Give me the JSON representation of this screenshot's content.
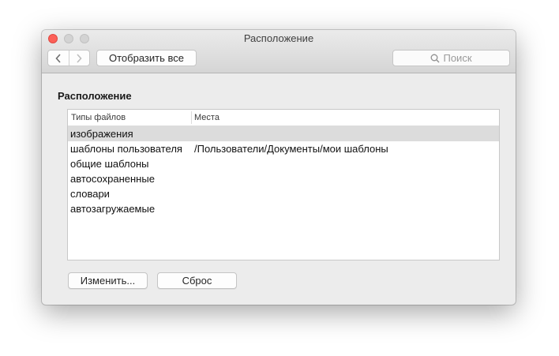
{
  "window": {
    "title": "Расположение"
  },
  "toolbar": {
    "show_all_label": "Отобразить все",
    "search_placeholder": "Поиск",
    "icons": [
      "chevron-left-icon",
      "chevron-right-icon",
      "search-icon"
    ]
  },
  "section": {
    "title": "Расположение"
  },
  "table": {
    "columns": [
      "Типы файлов",
      "Места"
    ],
    "rows": [
      {
        "type": "изображения",
        "location": ""
      },
      {
        "type": "шаблоны пользователя",
        "location": "/Пользователи/Документы/мои шаблоны"
      },
      {
        "type": "общие шаблоны",
        "location": ""
      },
      {
        "type": "автосохраненные",
        "location": ""
      },
      {
        "type": "словари",
        "location": ""
      },
      {
        "type": "автозагружаемые",
        "location": ""
      }
    ],
    "selected_index": 0
  },
  "buttons": {
    "change_label": "Изменить...",
    "reset_label": "Сброс"
  },
  "colors": {
    "close": "#fc5f57",
    "window_bg": "#ececec",
    "selected_row": "#dcdcdc"
  }
}
